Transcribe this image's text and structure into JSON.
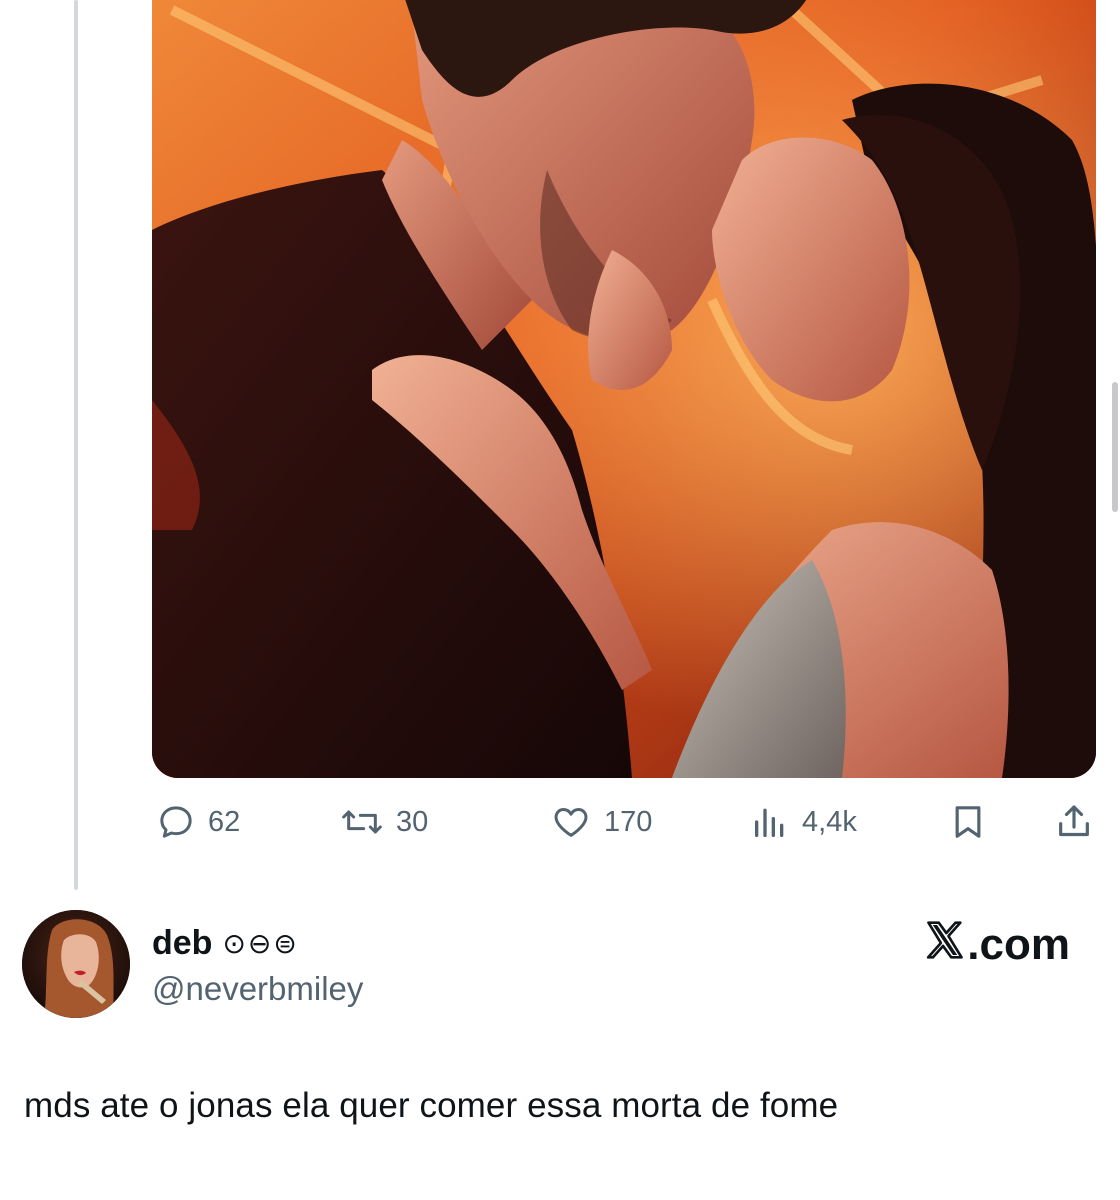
{
  "tweet": {
    "image": {
      "alt": "",
      "colors": {
        "background_warm": "#e0561c",
        "shadow": "#2a0d08"
      }
    },
    "actions": {
      "reply_count": "62",
      "retweet_count": "30",
      "like_count": "170",
      "views_count": "4,4k"
    }
  },
  "quote": {
    "display_name": "deb",
    "badges": [
      "⊙",
      "⊖",
      "⊜"
    ],
    "handle": "@neverbmiley",
    "brand": ".com",
    "text": "mds ate o jonas ela quer comer essa morta de fome"
  },
  "colors": {
    "secondary_text": "#536471",
    "primary_text": "#0f1419",
    "thread_line": "#cfd9de"
  },
  "icons": [
    "reply-icon",
    "retweet-icon",
    "like-icon",
    "views-icon",
    "bookmark-icon",
    "share-icon",
    "x-logo-icon"
  ]
}
